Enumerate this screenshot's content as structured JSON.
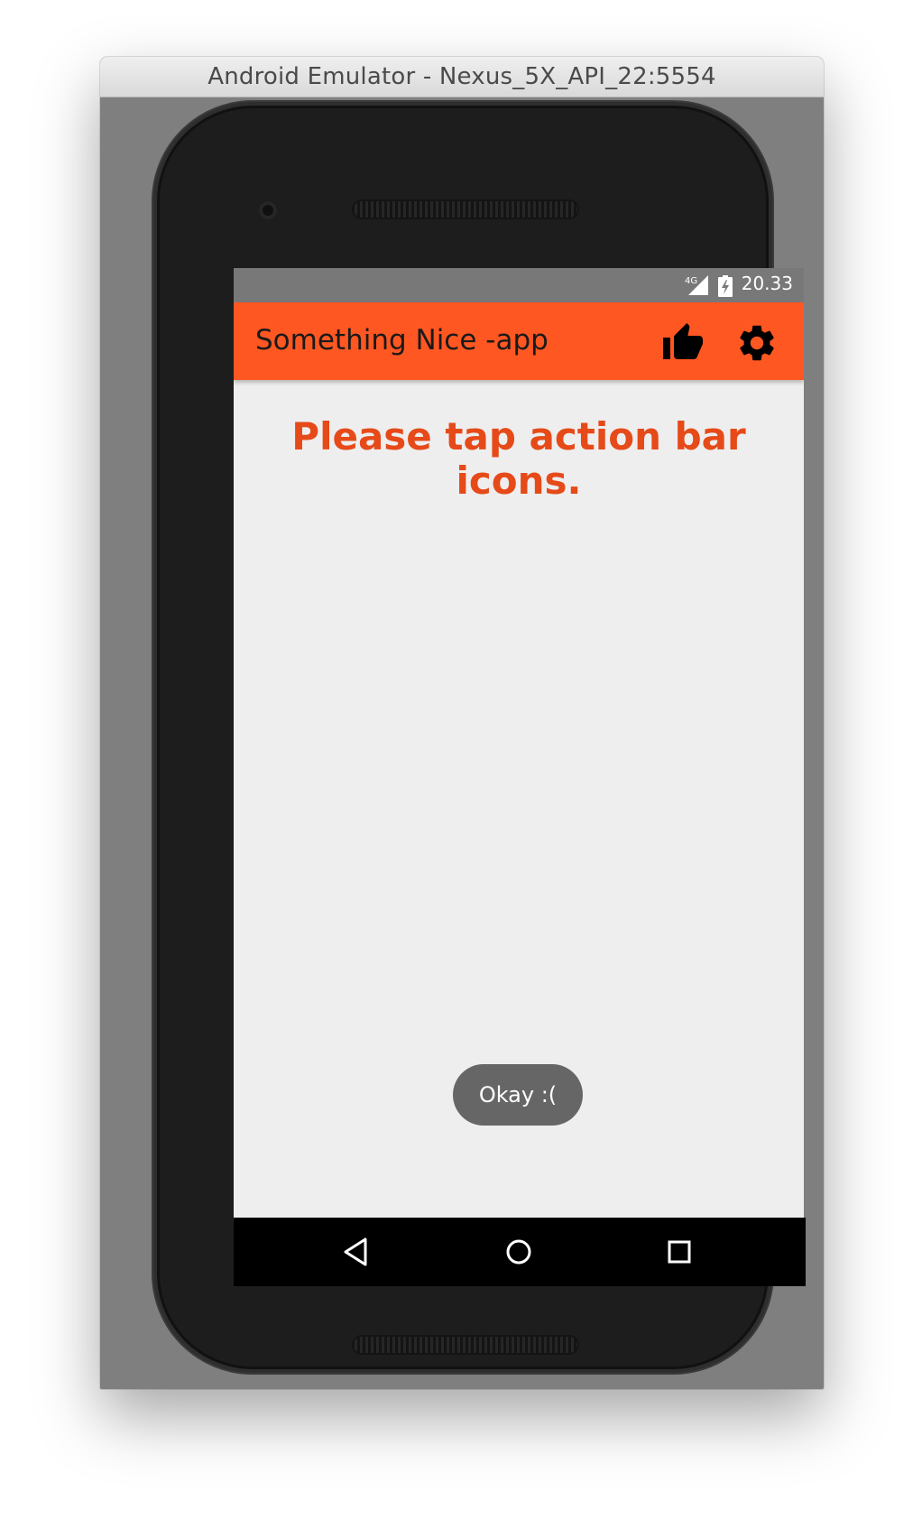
{
  "window": {
    "title": "Android Emulator - Nexus_5X_API_22:5554"
  },
  "status_bar": {
    "network_label": "4G",
    "time": "20.33"
  },
  "action_bar": {
    "title": "Something Nice -app",
    "background_color": "#ff5722",
    "actions": [
      {
        "icon": "thumbs-up-icon"
      },
      {
        "icon": "gear-icon"
      }
    ]
  },
  "content": {
    "message": "Please tap action bar icons.",
    "message_color": "#e64a19"
  },
  "toast": {
    "text": "Okay :("
  },
  "nav_bar": {
    "buttons": [
      {
        "icon": "back-icon"
      },
      {
        "icon": "home-icon"
      },
      {
        "icon": "recents-icon"
      }
    ]
  }
}
